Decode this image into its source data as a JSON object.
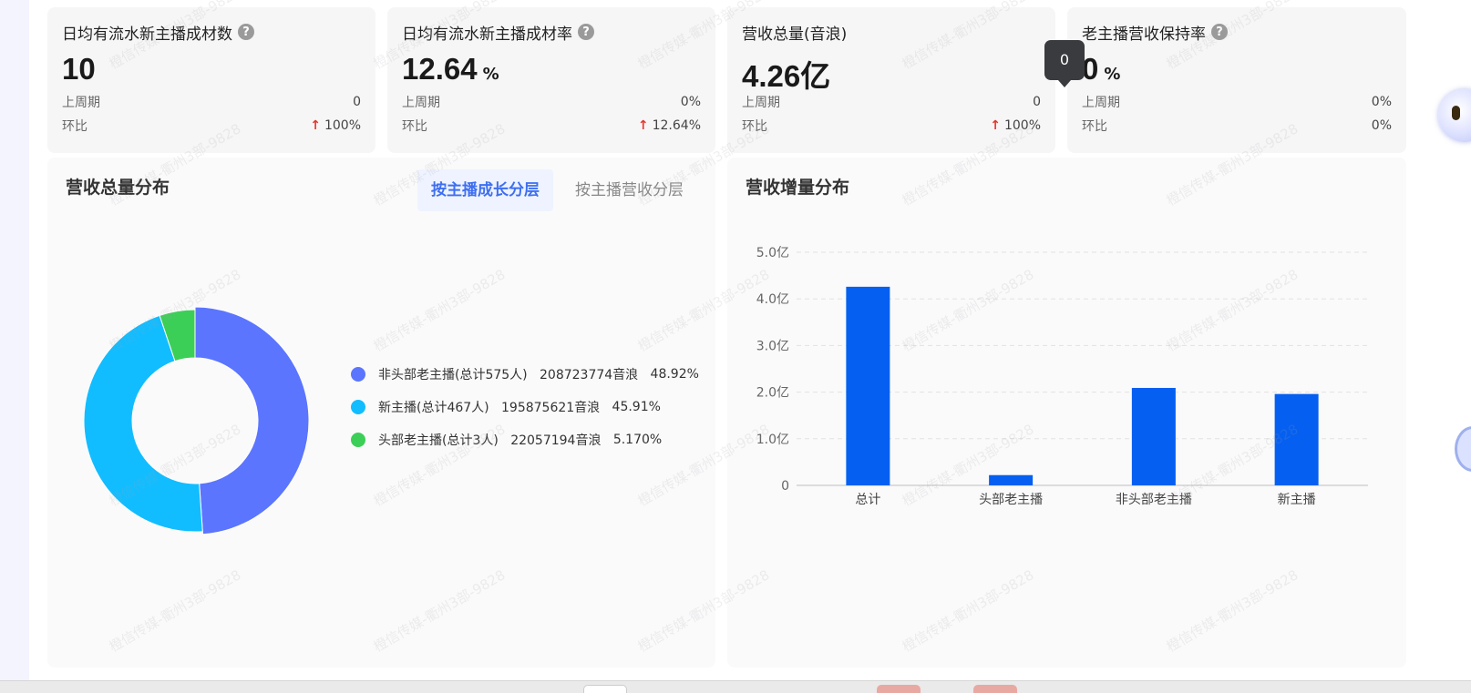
{
  "cards": [
    {
      "title": "日均有流水新主播成材数",
      "value": "10",
      "unit": "",
      "prev_label": "上周期",
      "prev_value": "0",
      "ratio_label": "环比",
      "ratio_value": "100%",
      "ratio_up": true,
      "help": true
    },
    {
      "title": "日均有流水新主播成材率",
      "value": "12.64",
      "unit": "%",
      "prev_label": "上周期",
      "prev_value": "0%",
      "ratio_label": "环比",
      "ratio_value": "12.64%",
      "ratio_up": true,
      "help": true
    },
    {
      "title": "营收总量(音浪)",
      "value": "4.26亿",
      "unit": "",
      "prev_label": "上周期",
      "prev_value": "0",
      "ratio_label": "环比",
      "ratio_value": "100%",
      "ratio_up": true,
      "help": false
    },
    {
      "title": "老主播营收保持率",
      "value": "0",
      "unit": "%",
      "prev_label": "上周期",
      "prev_value": "0%",
      "ratio_label": "环比",
      "ratio_value": "0%",
      "ratio_up": false,
      "help": true
    }
  ],
  "help_glyph": "?",
  "up_arrow_glyph": "↑",
  "tooltip_value": "0",
  "left_panel": {
    "title": "营收总量分布",
    "tabs": [
      {
        "label": "按主播成长分层",
        "active": true
      },
      {
        "label": "按主播营收分层",
        "active": false
      }
    ]
  },
  "right_panel": {
    "title": "营收增量分布"
  },
  "watermark": "橙信传媒-衢州3部-9828",
  "chart_data": [
    {
      "type": "pie",
      "donut": true,
      "legend_position": "right",
      "slices": [
        {
          "label": "非头部老主播(总计575人)",
          "value": 208723774,
          "value_text": "208723774音浪",
          "percent": 48.92,
          "percent_text": "48.92%",
          "color": "#5b75ff"
        },
        {
          "label": "新主播(总计467人)",
          "value": 195875621,
          "value_text": "195875621音浪",
          "percent": 45.91,
          "percent_text": "45.91%",
          "color": "#12bdff"
        },
        {
          "label": "头部老主播(总计3人)",
          "value": 22057194,
          "value_text": "22057194音浪",
          "percent": 5.17,
          "percent_text": "5.170%",
          "color": "#3ccf57"
        }
      ]
    },
    {
      "type": "bar",
      "categories": [
        "总计",
        "头部老主播",
        "非头部老主播",
        "新主播"
      ],
      "values": [
        4.26,
        0.22,
        2.09,
        1.96
      ],
      "ylim": [
        0,
        5
      ],
      "yticks": [
        0,
        1,
        2,
        3,
        4,
        5
      ],
      "ytick_labels": [
        "0",
        "1.0亿",
        "2.0亿",
        "3.0亿",
        "4.0亿",
        "5.0亿"
      ],
      "grid": true,
      "bar_color": "#055ff0",
      "title": "",
      "xlabel": "",
      "ylabel": ""
    }
  ]
}
